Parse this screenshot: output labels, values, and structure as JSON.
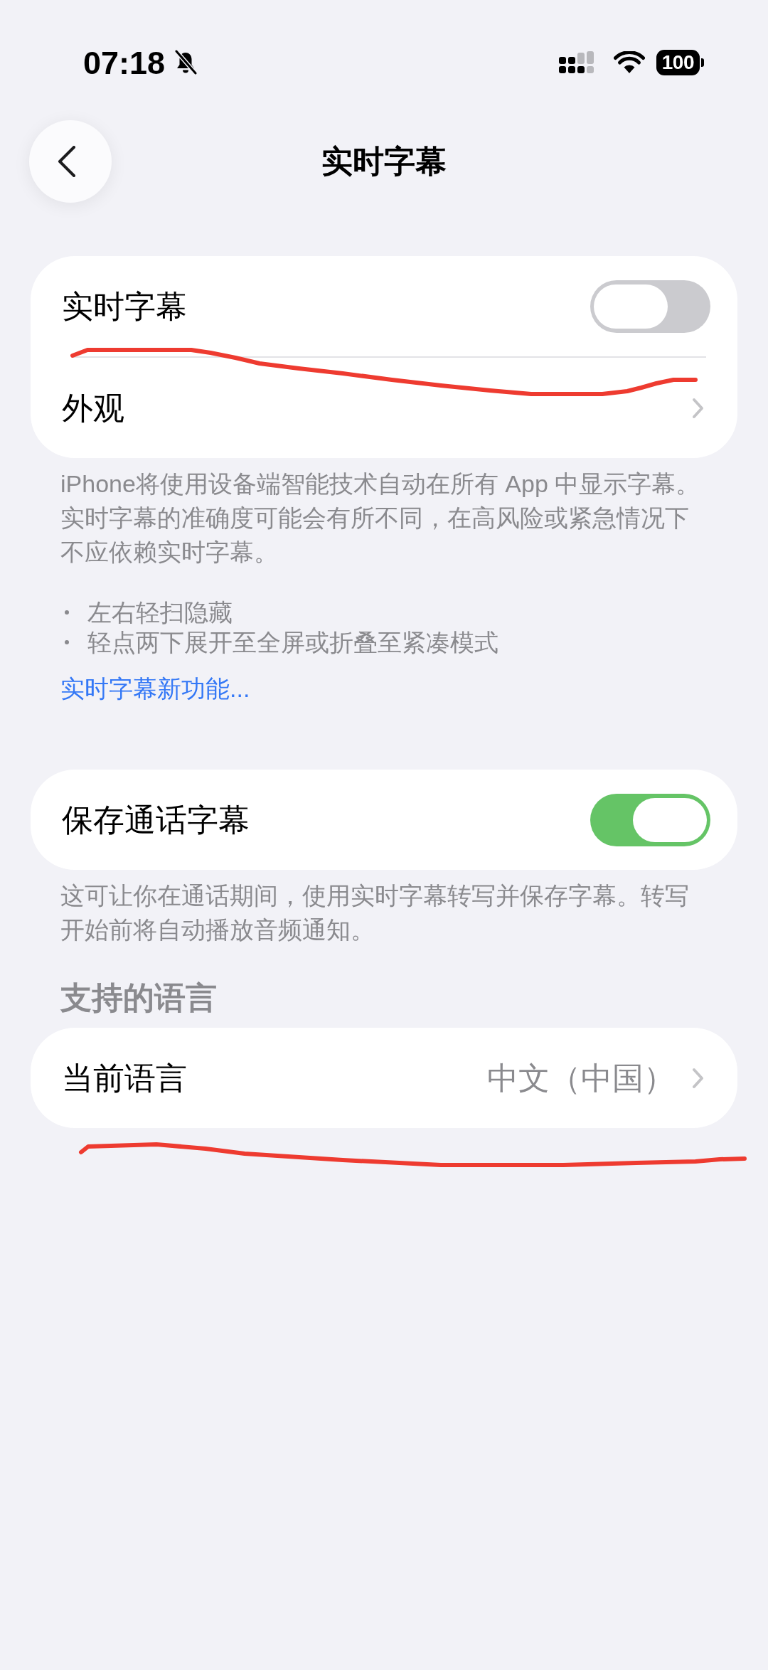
{
  "status_bar": {
    "time": "07:18",
    "battery": "100"
  },
  "nav": {
    "title": "实时字幕"
  },
  "groups": [
    {
      "rows": [
        {
          "kind": "toggle",
          "label": "实时字幕",
          "on": false
        },
        {
          "kind": "link",
          "label": "外观"
        }
      ],
      "footer": {
        "text": "iPhone将使用设备端智能技术自动在所有 App 中显示字幕。实时字幕的准确度可能会有所不同，在高风险或紧急情况下不应依赖实时字幕。",
        "bullets": [
          "左右轻扫隐藏",
          "轻点两下展开至全屏或折叠至紧凑模式"
        ],
        "link": "实时字幕新功能..."
      }
    },
    {
      "rows": [
        {
          "kind": "toggle",
          "label": "保存通话字幕",
          "on": true
        }
      ],
      "footer": {
        "text": "这可让你在通话期间，使用实时字幕转写并保存字幕。转写开始前将自动播放音频通知。"
      }
    },
    {
      "header": "支持的语言",
      "rows": [
        {
          "kind": "link",
          "label": "当前语言",
          "value": "中文（中国）"
        }
      ]
    }
  ]
}
